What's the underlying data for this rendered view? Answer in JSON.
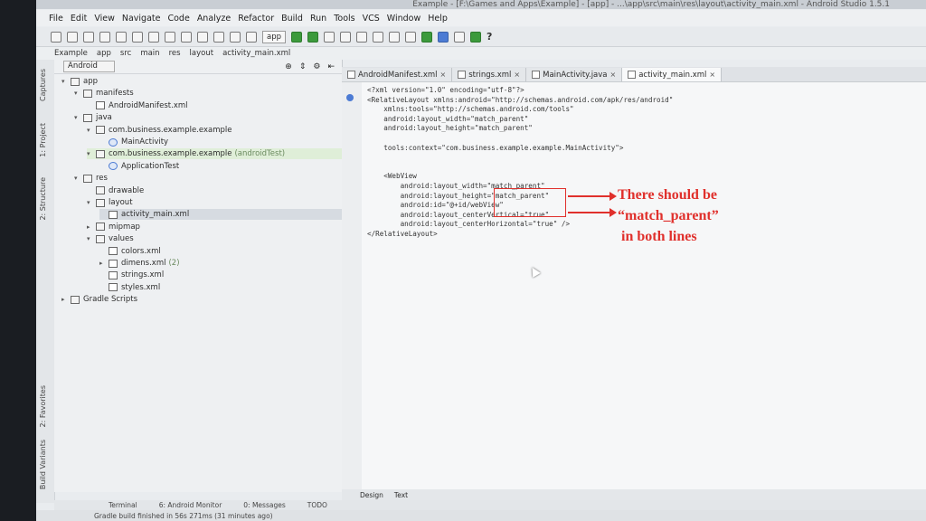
{
  "window": {
    "title": "Example - [F:\\Games and Apps\\Example] - [app] - ...\\app\\src\\main\\res\\layout\\activity_main.xml - Android Studio 1.5.1"
  },
  "menu": [
    "File",
    "Edit",
    "View",
    "Navigate",
    "Code",
    "Analyze",
    "Refactor",
    "Build",
    "Run",
    "Tools",
    "VCS",
    "Window",
    "Help"
  ],
  "toolbar": {
    "run_config": "app",
    "help": "?"
  },
  "breadcrumb": [
    "Example",
    "app",
    "src",
    "main",
    "res",
    "layout",
    "activity_main.xml"
  ],
  "side_tabs": {
    "captures": "Captures",
    "project": "1: Project",
    "structure": "2: Structure",
    "favorites": "2: Favorites",
    "build_variants": "Build Variants"
  },
  "project_panel": {
    "view_mode": "Android"
  },
  "tree": [
    {
      "label": "app",
      "indent": 0,
      "icon": "folder-icon",
      "twisty": "▾"
    },
    {
      "label": "manifests",
      "indent": 1,
      "icon": "folder-icon",
      "twisty": "▾"
    },
    {
      "label": "AndroidManifest.xml",
      "indent": 2,
      "icon": "xml-file-icon",
      "twisty": ""
    },
    {
      "label": "java",
      "indent": 1,
      "icon": "folder-icon",
      "twisty": "▾"
    },
    {
      "label": "com.business.example.example",
      "indent": 2,
      "icon": "package-icon",
      "twisty": "▾"
    },
    {
      "label": "MainActivity",
      "indent": 3,
      "icon": "class-icon",
      "twisty": ""
    },
    {
      "label": "com.business.example.example",
      "suffix": "(androidTest)",
      "indent": 2,
      "icon": "package-icon",
      "twisty": "▾",
      "highlight": "green"
    },
    {
      "label": "ApplicationTest",
      "indent": 3,
      "icon": "class-icon",
      "twisty": ""
    },
    {
      "label": "res",
      "indent": 1,
      "icon": "folder-icon",
      "twisty": "▾"
    },
    {
      "label": "drawable",
      "indent": 2,
      "icon": "folder-icon",
      "twisty": ""
    },
    {
      "label": "layout",
      "indent": 2,
      "icon": "folder-icon",
      "twisty": "▾"
    },
    {
      "label": "activity_main.xml",
      "indent": 3,
      "icon": "xml-file-icon",
      "twisty": "",
      "highlight": "selected"
    },
    {
      "label": "mipmap",
      "indent": 2,
      "icon": "folder-icon",
      "twisty": "▸"
    },
    {
      "label": "values",
      "indent": 2,
      "icon": "folder-icon",
      "twisty": "▾"
    },
    {
      "label": "colors.xml",
      "indent": 3,
      "icon": "xml-file-icon",
      "twisty": ""
    },
    {
      "label": "dimens.xml",
      "suffix": "(2)",
      "indent": 3,
      "icon": "xml-file-icon",
      "twisty": "▸"
    },
    {
      "label": "strings.xml",
      "indent": 3,
      "icon": "xml-file-icon",
      "twisty": ""
    },
    {
      "label": "styles.xml",
      "indent": 3,
      "icon": "xml-file-icon",
      "twisty": ""
    },
    {
      "label": "Gradle Scripts",
      "indent": 0,
      "icon": "gradle-icon",
      "twisty": "▸"
    }
  ],
  "tabs": [
    {
      "label": "AndroidManifest.xml",
      "active": false
    },
    {
      "label": "strings.xml",
      "active": false
    },
    {
      "label": "MainActivity.java",
      "active": false
    },
    {
      "label": "activity_main.xml",
      "active": true
    }
  ],
  "code": [
    "<?xml version=\"1.0\" encoding=\"utf-8\"?>",
    "<RelativeLayout xmlns:android=\"http://schemas.android.com/apk/res/android\"",
    "    xmlns:tools=\"http://schemas.android.com/tools\"",
    "    android:layout_width=\"match_parent\"",
    "    android:layout_height=\"match_parent\"",
    "",
    "    tools:context=\"com.business.example.example.MainActivity\">",
    "",
    "",
    "    <WebView",
    "        android:layout_width=\"match_parent\"",
    "        android:layout_height=\"match_parent\"",
    "        android:id=\"@+id/webView\"",
    "        android:layout_centerVertical=\"true\"",
    "        android:layout_centerHorizontal=\"true\" />",
    "</RelativeLayout>"
  ],
  "annotation": {
    "line1": "There should be",
    "line2": "“match_parent”",
    "line3": "in both lines",
    "color": "#e0302c"
  },
  "editor_bottom_tabs": [
    "Design",
    "Text"
  ],
  "tool_windows": [
    "Terminal",
    "6: Android Monitor",
    "0: Messages",
    "TODO"
  ],
  "status": "Gradle build finished in 56s 271ms (31 minutes ago)"
}
